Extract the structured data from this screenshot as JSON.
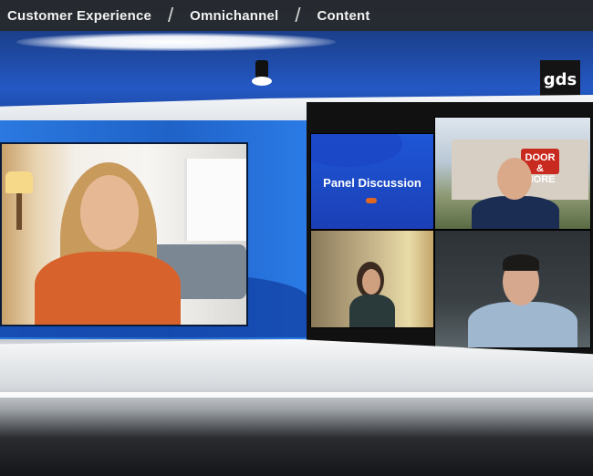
{
  "breadcrumb": {
    "items": [
      "Customer Experience",
      "Omnichannel",
      "Content"
    ],
    "separator": "/"
  },
  "logo": {
    "text": "gds"
  },
  "video_tiles": {
    "panel_title": "Panel Discussion",
    "store_sign": "DOOR & MORE"
  },
  "colors": {
    "wall_blue": "#1f62c8",
    "panel_blue": "#1e56d6",
    "topbar": "#282c32",
    "store_sign_red": "#c92a1f"
  }
}
